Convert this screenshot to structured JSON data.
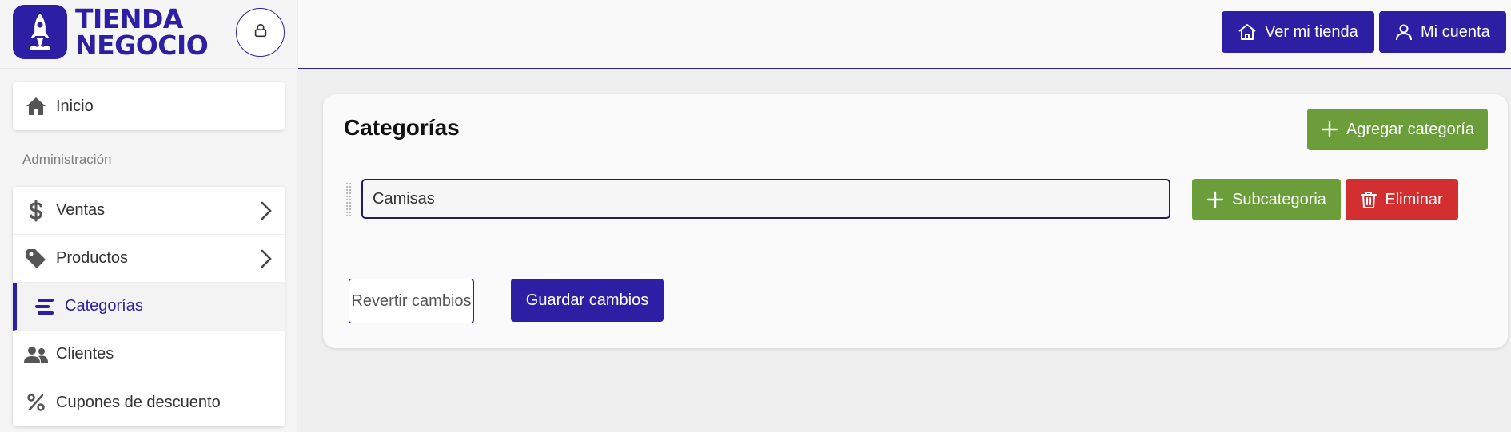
{
  "brand": {
    "line1": "TIENDA",
    "line2": "NEGOCIO"
  },
  "topbar": {
    "store_button": "Ver mi tienda",
    "account_button": "Mi cuenta"
  },
  "sidebar": {
    "home_label": "Inicio",
    "section_label": "Administración",
    "items": [
      {
        "label": "Ventas",
        "icon": "dollar-icon",
        "has_chevron": true
      },
      {
        "label": "Productos",
        "icon": "tag-icon",
        "has_chevron": true
      },
      {
        "label": "Categorías",
        "icon": "categories-icon",
        "active": true
      },
      {
        "label": "Clientes",
        "icon": "users-icon"
      },
      {
        "label": "Cupones de descuento",
        "icon": "percent-icon"
      }
    ]
  },
  "main": {
    "title": "Categorías",
    "add_button": "Agregar categoría",
    "category": {
      "value": "Camisas"
    },
    "subcategory_button": "Subcategoria",
    "delete_button": "Eliminar",
    "revert_button": "Revertir cambios",
    "save_button": "Guardar cambios"
  },
  "colors": {
    "brand": "#2d1fa3",
    "success": "#6b9d3a",
    "danger": "#d42f30"
  }
}
